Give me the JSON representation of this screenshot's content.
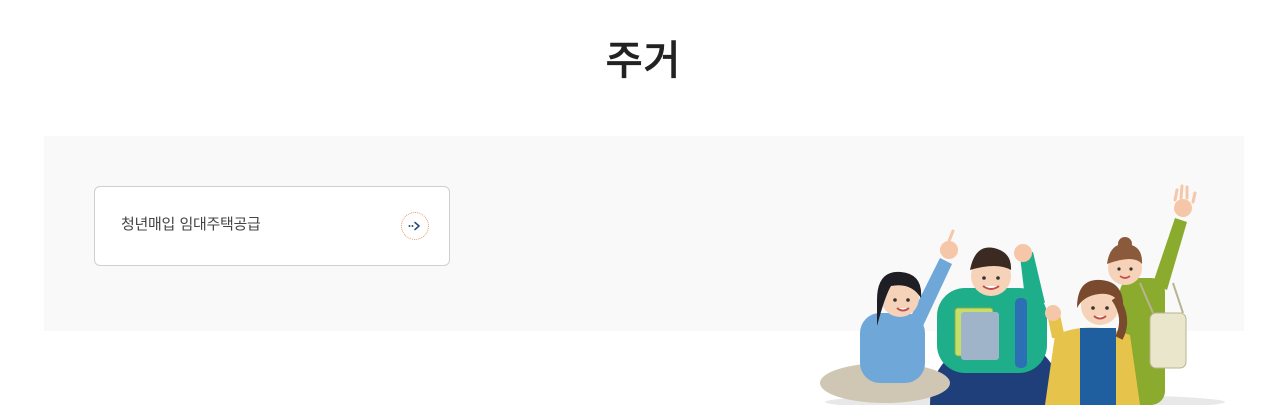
{
  "page": {
    "title": "주거"
  },
  "cards": [
    {
      "label": "청년매입 임대주택공급",
      "icon": "arrow-right-icon"
    }
  ],
  "colors": {
    "panel_bg": "#f9f9f9",
    "card_border": "#cfcfcf",
    "arrow_accent": "#e39a6a",
    "arrow_color": "#2b4a7a"
  },
  "illustration": {
    "name": "young-people-illustration"
  }
}
